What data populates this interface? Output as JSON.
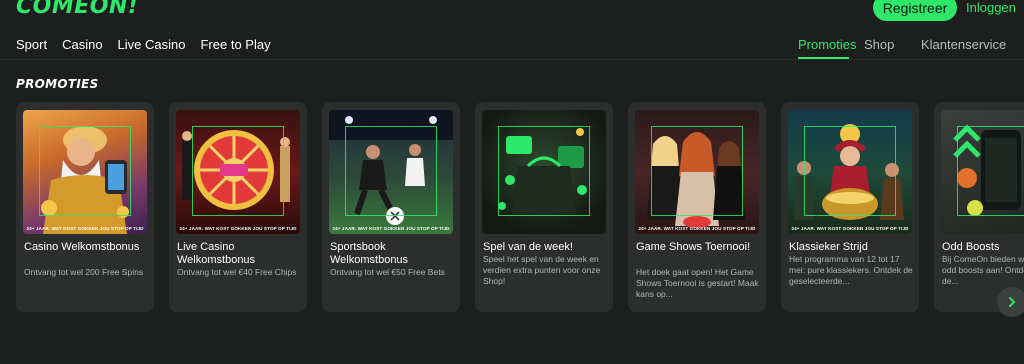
{
  "brand": {
    "logo": "COMEON!",
    "accent": "#2ee86a"
  },
  "header": {
    "register_label": "Registreer",
    "login_label": "Inloggen"
  },
  "nav": {
    "main": [
      "Sport",
      "Casino",
      "Live Casino",
      "Free to Play"
    ],
    "promoties": "Promoties",
    "shop": "Shop",
    "klantenservice": "Klantenservice"
  },
  "section": {
    "title": "PROMOTIES"
  },
  "disclaimer": "24+ JAAR. WAT KOST GOKKEN JOU STOP OP TIJD",
  "cards": [
    {
      "title": "Casino Welkomstbonus",
      "subtitle": "Ontvang tot wel 200 Free Spins",
      "image": "zeus-casino-illustration"
    },
    {
      "title": "Live Casino Welkomstbonus",
      "subtitle": "Ontvang tot wel €40 Free Chips",
      "image": "crazy-time-wheel"
    },
    {
      "title": "Sportsbook Welkomstbonus",
      "subtitle": "Ontvang tot wel €50 Free Bets",
      "image": "football-players"
    },
    {
      "title": "Spel van de week!",
      "subtitle": "Speel het spel van de week en verdien extra punten voor onze Shop!",
      "image": "green-gift-bag-10x"
    },
    {
      "title": "Game Shows Toernooi!",
      "subtitle": "Het doek gaat open! Het Game Shows Toernooi is gestart! Maak kans op...",
      "image": "game-show-hosts"
    },
    {
      "title": "Klassieker Strijd",
      "subtitle": "Het programma van 12 tot 17 mei: pure klassiekers. Ontdek de geselecteerde...",
      "image": "classic-slot-characters"
    },
    {
      "title": "Odd Boosts",
      "subtitle": "Bij ComeOn bieden we de beste odd boosts aan! Ontdek hier de...",
      "image": "sports-phone-odds"
    }
  ]
}
